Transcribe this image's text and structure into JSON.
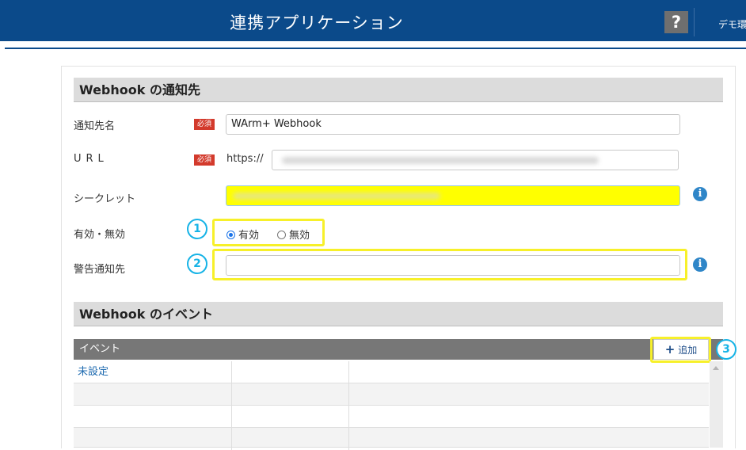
{
  "header": {
    "title": "連携アプリケーション",
    "help_label": "?",
    "user": "デモ環"
  },
  "webhook_section": {
    "title": "Webhook の通知先",
    "name": {
      "label": "通知先名",
      "required": "必須",
      "value": "WArm+ Webhook"
    },
    "url": {
      "label": "URL",
      "required": "必須",
      "prefix": "https://",
      "value": ""
    },
    "secret": {
      "label": "シークレット",
      "value": ""
    },
    "status": {
      "label": "有効・無効",
      "options": [
        "有効",
        "無効"
      ],
      "selected": "有効"
    },
    "alert": {
      "label": "警告通知先",
      "value": ""
    }
  },
  "events_section": {
    "title": "Webhook のイベント",
    "column": "イベント",
    "add_label": "追加",
    "rows": [
      "未設定",
      "",
      "",
      ""
    ]
  },
  "callouts": [
    "1",
    "2",
    "3"
  ],
  "colors": {
    "header": "#0b4a8a",
    "highlight": "#f7f02a",
    "callout": "#16b3e6",
    "required": "#d33a2c"
  },
  "icons": [
    "help-icon",
    "info-icon",
    "plus-icon"
  ]
}
